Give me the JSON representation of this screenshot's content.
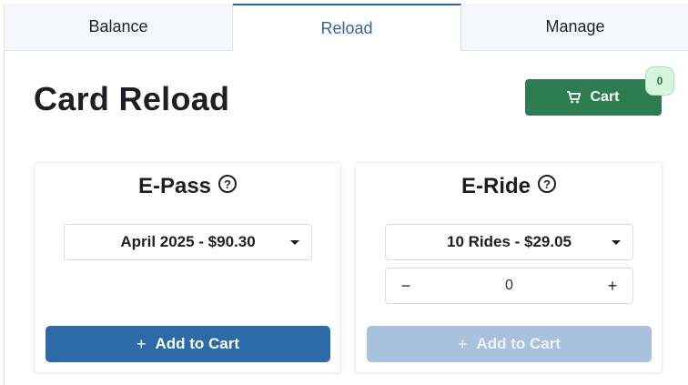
{
  "tabs": [
    {
      "label": "Balance"
    },
    {
      "label": "Reload"
    },
    {
      "label": "Manage"
    }
  ],
  "page": {
    "title": "Card Reload"
  },
  "cart": {
    "label": "Cart",
    "count": "0",
    "icon": "cart-icon",
    "color": "#2e7d50"
  },
  "epass": {
    "title": "E-Pass",
    "help_icon": "?",
    "selected": "April 2025 - $90.30",
    "add_label": "Add to Cart"
  },
  "eride": {
    "title": "E-Ride",
    "help_icon": "?",
    "selected": "10 Rides - $29.05",
    "quantity": "0",
    "minus": "−",
    "plus": "+",
    "add_label": "Add to Cart"
  },
  "colors": {
    "accent": "#2d6aa8",
    "disabled": "#a9c2dc",
    "active_tab": "#2e66a3"
  }
}
